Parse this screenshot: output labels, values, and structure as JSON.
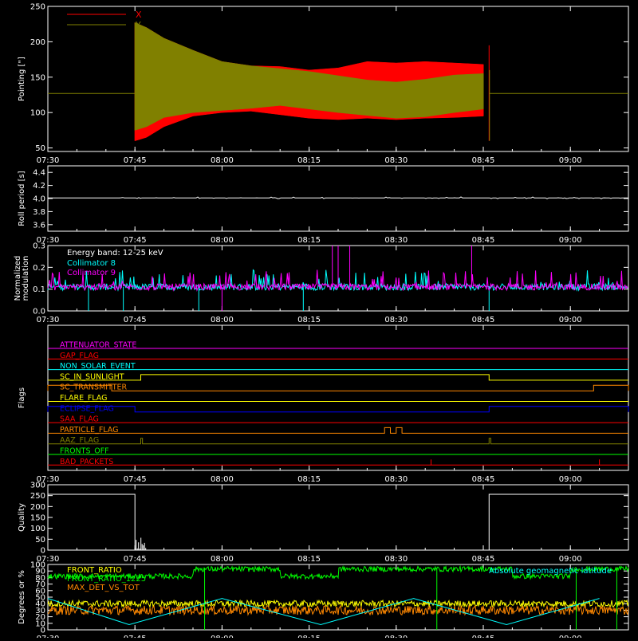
{
  "colors": {
    "background": "#000000",
    "axes": "#ffffff",
    "red": "#ff0000",
    "olive": "#808000",
    "cyan": "#00ffff",
    "magenta": "#ff00ff",
    "white": "#ffffff",
    "green": "#00ff00",
    "yellow": "#ffff00",
    "orange": "#ff8800",
    "blue": "#0000ff"
  },
  "chart_data": [
    {
      "type": "line",
      "id": "pointing",
      "ylabel": "Pointing [\"]",
      "ylim": [
        45,
        250
      ],
      "yticks": [
        50,
        100,
        150,
        200,
        250
      ],
      "xlim_minutes": [
        450,
        550
      ],
      "xtick_labels": [
        "07:30",
        "07:45",
        "08:00",
        "08:15",
        "08:30",
        "08:45",
        "09:00"
      ],
      "xtick_minutes": [
        450,
        465,
        480,
        495,
        510,
        525,
        540
      ],
      "baseline": 127,
      "active_interval": [
        "07:45",
        "08:46"
      ],
      "series": [
        {
          "name": "X",
          "color": "red",
          "envelope": [
            [
              "07:45",
              60,
              227
            ],
            [
              "07:47",
              65,
              220
            ],
            [
              "07:50",
              80,
              205
            ],
            [
              "07:55",
              95,
              188
            ],
            [
              "08:00",
              100,
              172
            ],
            [
              "08:05",
              102,
              166
            ],
            [
              "08:10",
              97,
              165
            ],
            [
              "08:15",
              92,
              160
            ],
            [
              "08:20",
              90,
              163
            ],
            [
              "08:25",
              92,
              172
            ],
            [
              "08:30",
              90,
              170
            ],
            [
              "08:35",
              92,
              172
            ],
            [
              "08:40",
              93,
              170
            ],
            [
              "08:45",
              95,
              168
            ]
          ]
        },
        {
          "name": "Y",
          "color": "olive",
          "envelope": [
            [
              "07:45",
              75,
              227
            ],
            [
              "07:47",
              80,
              220
            ],
            [
              "07:50",
              93,
              205
            ],
            [
              "07:55",
              100,
              188
            ],
            [
              "08:00",
              103,
              172
            ],
            [
              "08:05",
              106,
              166
            ],
            [
              "08:10",
              110,
              162
            ],
            [
              "08:15",
              105,
              158
            ],
            [
              "08:20",
              100,
              152
            ],
            [
              "08:25",
              96,
              146
            ],
            [
              "08:30",
              92,
              143
            ],
            [
              "08:35",
              94,
              147
            ],
            [
              "08:40",
              100,
              153
            ],
            [
              "08:45",
              105,
              155
            ]
          ]
        }
      ],
      "spike": [
        "08:46",
        60,
        195
      ]
    },
    {
      "type": "line",
      "id": "roll",
      "ylabel": "Roll period [s]",
      "ylim": [
        3.5,
        4.5
      ],
      "yticks": [
        3.6,
        3.8,
        4.0,
        4.2,
        4.4
      ],
      "ytick_labels": [
        "3.6",
        "3.8",
        "4.0",
        "4.2",
        "4.4"
      ],
      "series": [
        {
          "color": "white",
          "value": 4.01
        }
      ]
    },
    {
      "type": "line",
      "id": "modulation",
      "ylabel": "Normalized\nmodulation",
      "ylim": [
        0,
        0.3
      ],
      "yticks": [
        0.0,
        0.1,
        0.2,
        0.3
      ],
      "ytick_labels": [
        "0.0",
        "0.1",
        "0.2",
        "0.3"
      ],
      "annotation": "Energy band: 12-25 keV",
      "series": [
        {
          "name": "Collimator 8",
          "color": "cyan",
          "base": 0.11,
          "dips": [
            "07:37",
            "07:43",
            "07:56",
            "08:14",
            "08:46"
          ]
        },
        {
          "name": "Collimator 9",
          "color": "magenta",
          "base": 0.11,
          "spikes": [
            "08:19",
            "08:20",
            "08:22",
            "08:43"
          ],
          "dips": [
            "08:00"
          ]
        }
      ]
    },
    {
      "type": "line",
      "id": "flags",
      "ylabel": "Flags",
      "flags": [
        {
          "name": "ATTENUATOR_STATE",
          "color": "magenta"
        },
        {
          "name": "GAP_FLAG",
          "color": "red"
        },
        {
          "name": "NON_SOLAR_EVENT",
          "color": "cyan"
        },
        {
          "name": "SC_IN_SUNLIGHT",
          "color": "yellow",
          "high": [
            [
              "07:46",
              "08:46"
            ]
          ]
        },
        {
          "name": "SC_TRANSMITTER",
          "color": "orange",
          "high": [
            [
              "07:30",
              "07:41"
            ],
            [
              "09:04",
              "09:10"
            ]
          ]
        },
        {
          "name": "FLARE_FLAG",
          "color": "yellow"
        },
        {
          "name": "ECLIPSE_FLAG",
          "color": "blue",
          "high": [
            [
              "07:30",
              "07:45"
            ],
            [
              "08:46",
              "09:10"
            ]
          ]
        },
        {
          "name": "SAA_FLAG",
          "color": "red"
        },
        {
          "name": "PARTICLE_FLAG",
          "color": "orange",
          "high": [
            [
              "08:28",
              "08:29"
            ],
            [
              "08:30",
              "08:31"
            ]
          ]
        },
        {
          "name": "AAZ_FLAG",
          "color": "olive",
          "high": [
            [
              "07:46",
              "07:46.3"
            ],
            [
              "08:46",
              "08:46.3"
            ]
          ]
        },
        {
          "name": "FRONTS_OFF",
          "color": "green"
        },
        {
          "name": "BAD_PACKETS",
          "color": "red",
          "ticks": [
            "08:36",
            "09:05"
          ]
        }
      ]
    },
    {
      "type": "line",
      "id": "quality",
      "ylabel": "Quality",
      "ylim": [
        0,
        300
      ],
      "yticks": [
        0,
        50,
        100,
        150,
        200,
        250,
        300
      ],
      "series": [
        {
          "color": "white",
          "high": 256,
          "low": 0,
          "high_intervals": [
            [
              "07:30",
              "07:45"
            ],
            [
              "08:46",
              "09:10"
            ]
          ]
        }
      ]
    },
    {
      "type": "line",
      "id": "ratios",
      "ylabel": "Degrees or %",
      "ylim": [
        0,
        100
      ],
      "yticks": [
        0,
        10,
        20,
        30,
        40,
        50,
        60,
        70,
        80,
        90,
        100
      ],
      "series": [
        {
          "name": "FRONT_RATIO",
          "color": "yellow",
          "base": 40
        },
        {
          "name": "FRONT_RATIO_1225",
          "color": "green",
          "base": 93,
          "dip_level": 82,
          "dips": [
            [
              "07:30",
              "07:55"
            ],
            [
              "08:10",
              "08:20"
            ],
            [
              "08:50",
              "09:00"
            ]
          ]
        },
        {
          "name": "MAX_DET_VS_TOT",
          "color": "orange",
          "base": 30
        },
        {
          "name": "Absolute geomagnetic latitude",
          "color": "cyan",
          "peaks": [
            [
              450,
              48
            ],
            [
              464,
              8
            ],
            [
              480,
              48
            ],
            [
              497,
              8
            ],
            [
              513,
              48
            ],
            [
              529,
              8
            ],
            [
              545,
              48
            ]
          ]
        }
      ]
    }
  ]
}
